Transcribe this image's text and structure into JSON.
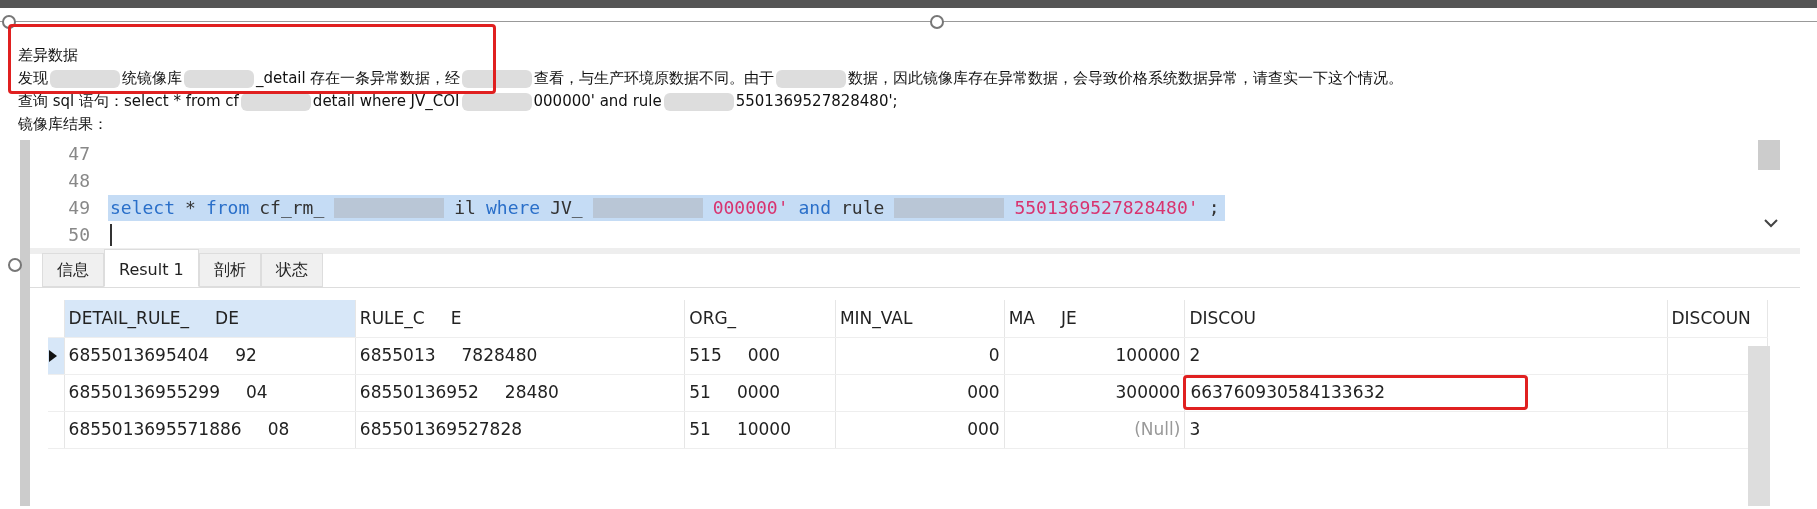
{
  "document": {
    "title": "差异数据",
    "lines": [
      {
        "segments": [
          "发现",
          "统镜像库",
          "_detail 存在一条异常数据，经",
          "查看，与生产环境原数据不同。由于",
          "数据，因此镜像库存在异常数据，会导致价格系统数据异常，请查实一下这个情况。"
        ]
      },
      {
        "segments": [
          "查询 sql 语句：select * from cf",
          "detail where JV_COI",
          "000000' and rule",
          "5501369527828480';"
        ]
      },
      {
        "segments": [
          "镜像库结果："
        ]
      }
    ]
  },
  "editor": {
    "lines": [
      {
        "number": "47"
      },
      {
        "number": "48"
      },
      {
        "number": "49",
        "selected": true,
        "segments": [
          {
            "kind": "keyword",
            "text": "select"
          },
          {
            "kind": "plain",
            "text": "*"
          },
          {
            "kind": "keyword",
            "text": "from"
          },
          {
            "kind": "plain",
            "text": "cf_rm_"
          },
          {
            "kind": "redacted"
          },
          {
            "kind": "plain",
            "text": "il"
          },
          {
            "kind": "keyword",
            "text": "where"
          },
          {
            "kind": "plain",
            "text": "JV_"
          },
          {
            "kind": "redacted"
          },
          {
            "kind": "string",
            "text": "000000'"
          },
          {
            "kind": "keyword",
            "text": "and"
          },
          {
            "kind": "plain",
            "text": "rule"
          },
          {
            "kind": "redacted"
          },
          {
            "kind": "string",
            "text": "5501369527828480'"
          },
          {
            "kind": "plain",
            "text": ";"
          }
        ]
      },
      {
        "number": "50",
        "cursor": true
      }
    ]
  },
  "tabs": [
    {
      "label": "信息",
      "selected": false
    },
    {
      "label": "Result 1",
      "selected": true
    },
    {
      "label": "剖析",
      "selected": false
    },
    {
      "label": "状态",
      "selected": false
    }
  ],
  "table": {
    "columns": [
      {
        "parts": [
          "DETAIL_RULE_",
          "DE"
        ],
        "selected": true
      },
      {
        "parts": [
          "RULE_C",
          "E"
        ],
        "selected": false
      },
      {
        "parts": [
          "ORG_"
        ],
        "selected": false
      },
      {
        "parts": [
          "MIN_VAL"
        ],
        "selected": false
      },
      {
        "parts": [
          "MA",
          "JE"
        ],
        "selected": false
      },
      {
        "parts": [
          "DISCOU"
        ],
        "selected": false
      },
      {
        "parts": [
          "DISCOUN"
        ],
        "selected": false
      }
    ],
    "rows": [
      {
        "selected": true,
        "cells": [
          {
            "parts": [
              "6855013695404",
              "92"
            ]
          },
          {
            "parts": [
              "6855013",
              "7828480"
            ]
          },
          {
            "parts": [
              "515",
              "000"
            ]
          },
          {
            "parts": [
              "0"
            ]
          },
          {
            "parts": [
              "100000"
            ]
          },
          {
            "parts": [
              "2"
            ]
          },
          null
        ]
      },
      {
        "selected": false,
        "cells": [
          {
            "parts": [
              "68550136955299",
              "04"
            ]
          },
          {
            "parts": [
              "68550136952",
              "28480"
            ]
          },
          {
            "parts": [
              "51",
              "0000"
            ]
          },
          {
            "parts": [
              "000"
            ]
          },
          {
            "parts": [
              "300000"
            ]
          },
          {
            "parts": [
              "663760930584133632"
            ],
            "highlighted": true
          },
          null
        ]
      },
      {
        "selected": false,
        "cells": [
          {
            "parts": [
              "6855013695571886",
              "08"
            ]
          },
          {
            "parts": [
              "685501369527828"
            ]
          },
          {
            "parts": [
              "51",
              "10000"
            ]
          },
          {
            "parts": [
              "000"
            ]
          },
          {
            "parts": [
              "(Null)"
            ],
            "kind": "null"
          },
          {
            "parts": [
              "3"
            ]
          },
          null
        ]
      }
    ]
  }
}
